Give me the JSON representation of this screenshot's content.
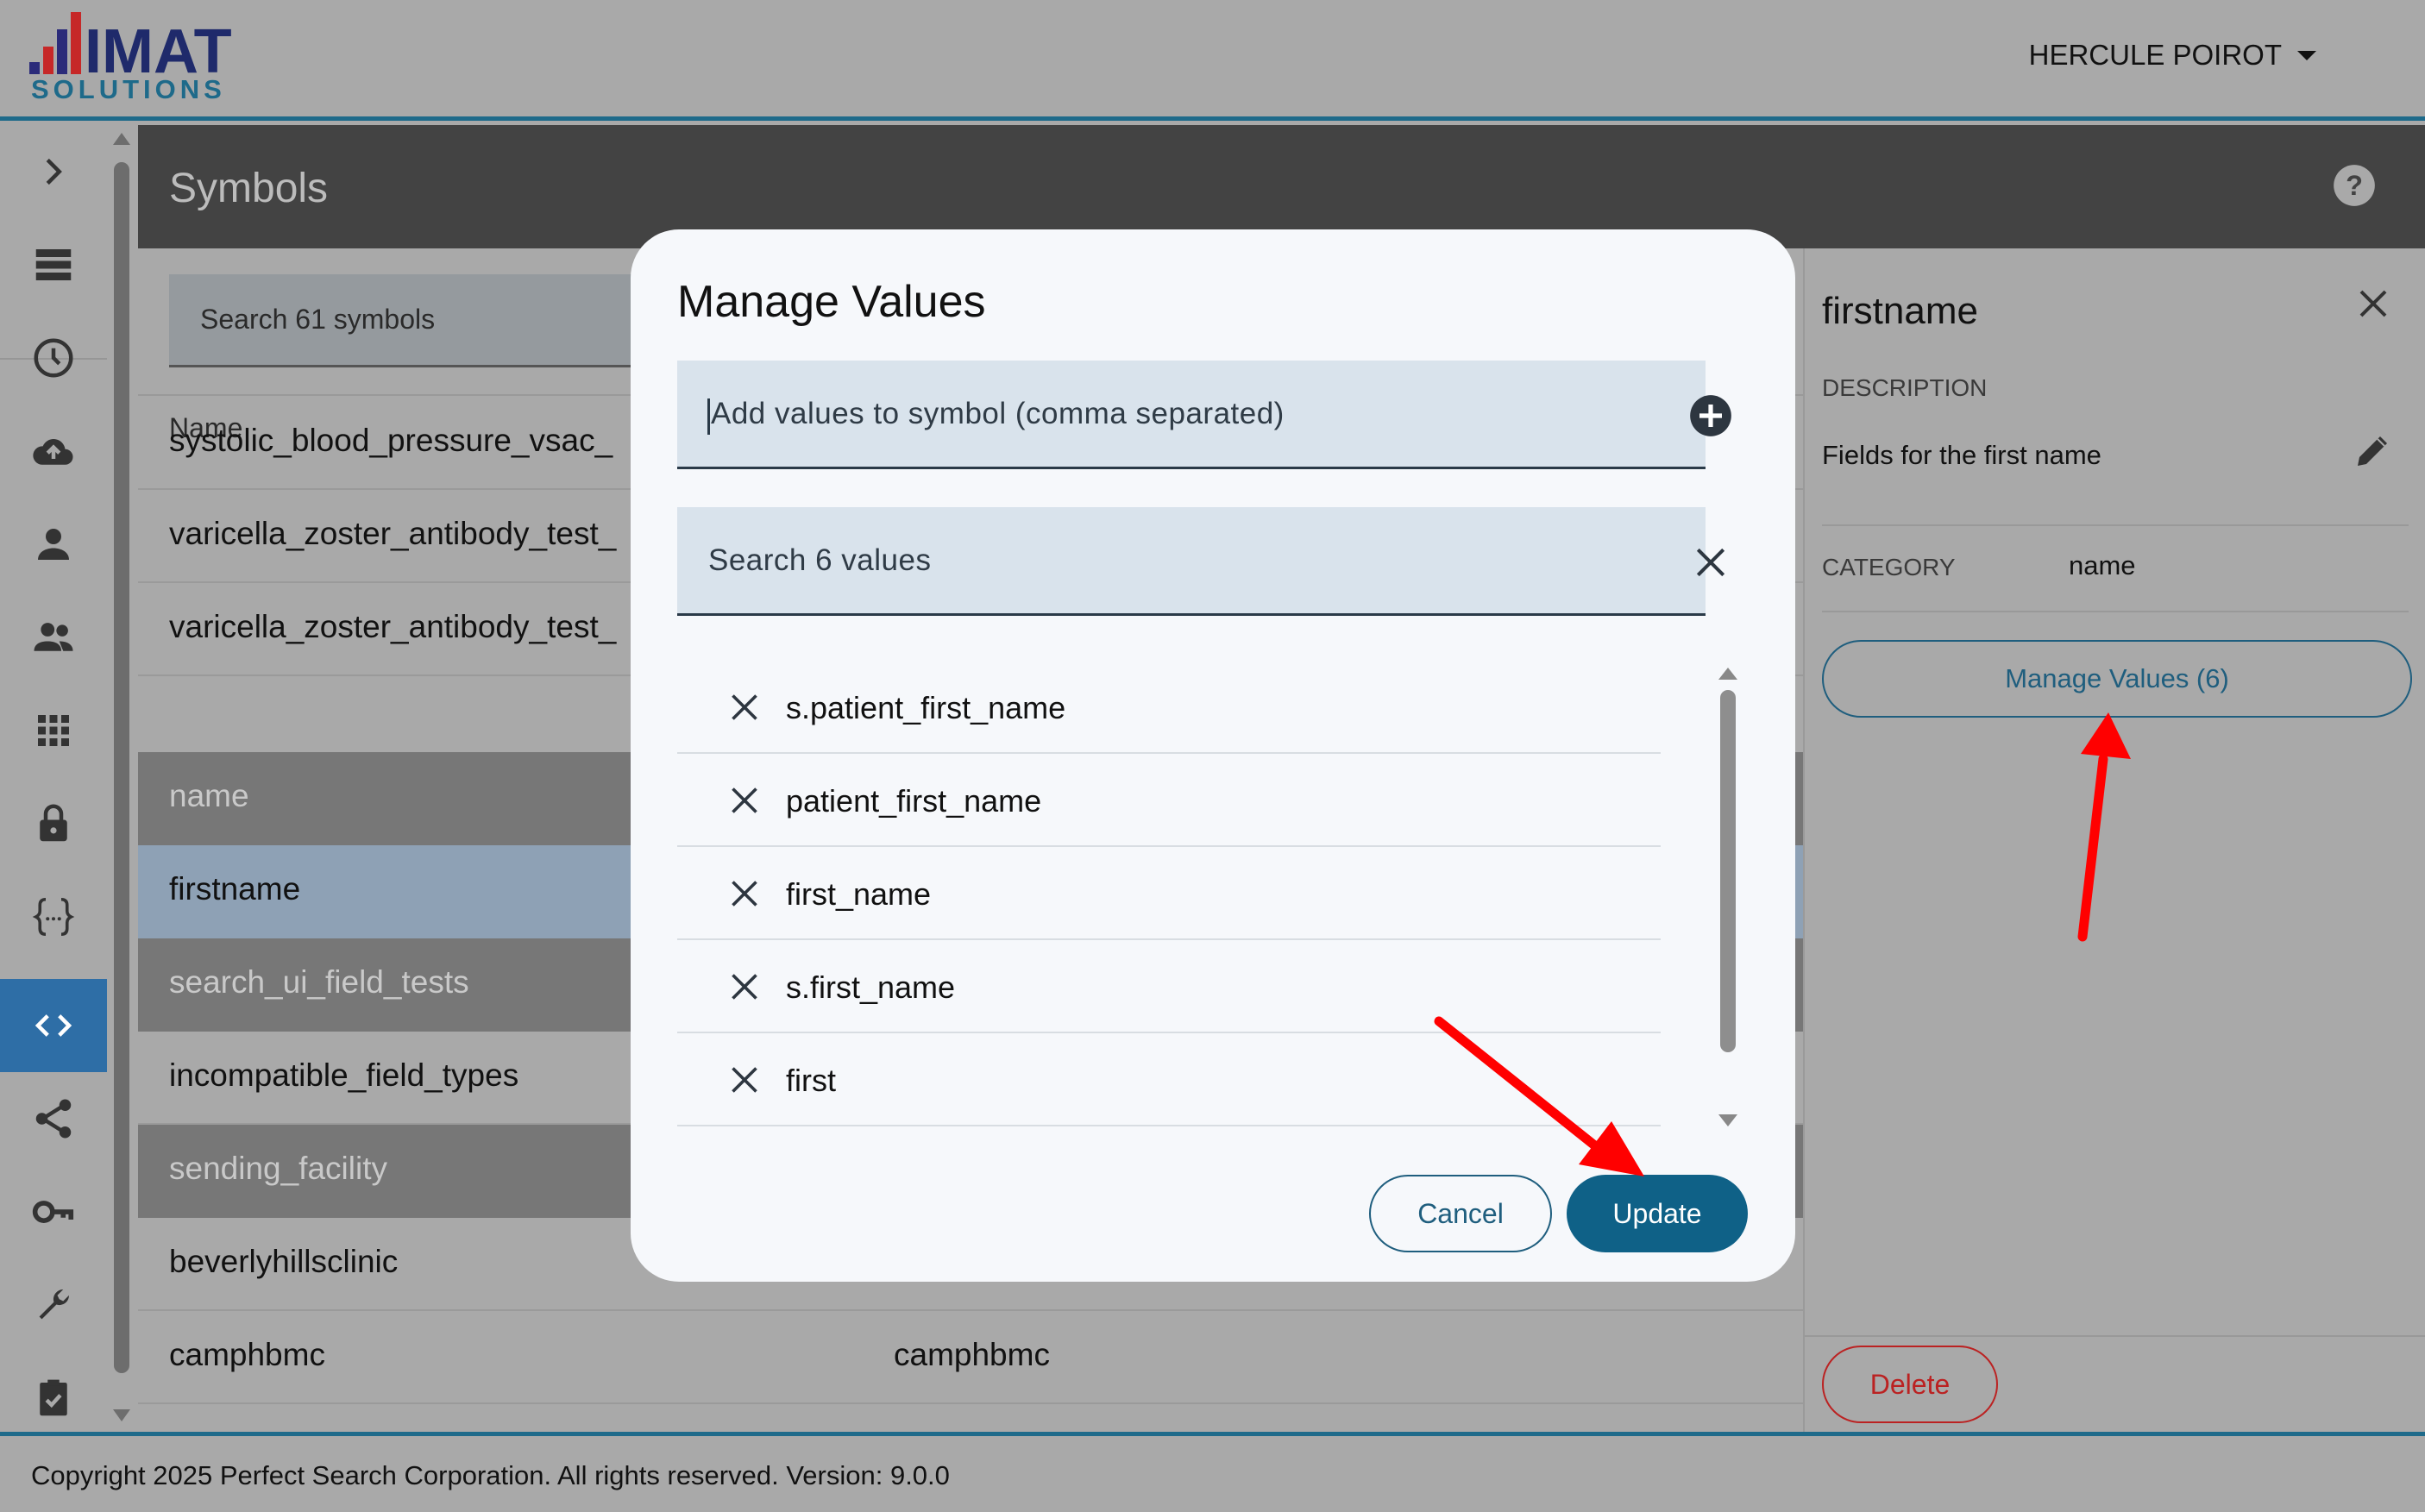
{
  "header": {
    "logo": {
      "line1": "IMAT",
      "line2": "SOLUTIONS"
    },
    "user_name": "HERCULE POIROT"
  },
  "nav": {
    "items": [
      {
        "icon": "chevron-right-icon"
      },
      {
        "icon": "list-icon"
      },
      {
        "icon": "history-icon"
      },
      {
        "icon": "cloud-upload-icon"
      },
      {
        "icon": "person-icon"
      },
      {
        "icon": "people-icon"
      },
      {
        "icon": "apps-grid-icon"
      },
      {
        "icon": "lock-icon"
      },
      {
        "icon": "curly-braces-icon"
      },
      {
        "icon": "code-icon",
        "active": true
      },
      {
        "icon": "share-icon"
      },
      {
        "icon": "key-icon"
      },
      {
        "icon": "wrench-icon"
      },
      {
        "icon": "clipboard-check-icon"
      }
    ]
  },
  "page": {
    "title": "Symbols",
    "search_placeholder": "Search 61 symbols",
    "column_name": "Name"
  },
  "table": {
    "rows": [
      {
        "name": "systolic_blood_pressure_vsac_",
        "value": "",
        "kind": "row"
      },
      {
        "name": "varicella_zoster_antibody_test_",
        "value": "",
        "kind": "row"
      },
      {
        "name": "varicella_zoster_antibody_test_",
        "value": "",
        "kind": "row"
      },
      {
        "name": "name",
        "value": "",
        "kind": "group"
      },
      {
        "name": "firstname",
        "value": "",
        "kind": "selected"
      },
      {
        "name": "search_ui_field_tests",
        "value": "",
        "kind": "group"
      },
      {
        "name": "incompatible_field_types",
        "value": "",
        "kind": "row"
      },
      {
        "name": "sending_facility",
        "value": "",
        "kind": "group"
      },
      {
        "name": "beverlyhillsclinic",
        "value": "",
        "kind": "row"
      },
      {
        "name": "camphbmc",
        "value": "camphbmc",
        "kind": "row"
      }
    ]
  },
  "detail": {
    "title": "firstname",
    "description_label": "DESCRIPTION",
    "description": "Fields for the first name",
    "category_label": "CATEGORY",
    "category": "name",
    "manage_button": "Manage Values (6)",
    "delete_button": "Delete"
  },
  "modal": {
    "title": "Manage Values",
    "add_placeholder": "Add values to symbol (comma separated)",
    "search_placeholder": "Search 6 values",
    "values": [
      "s.patient_first_name",
      "patient_first_name",
      "first_name",
      "s.first_name",
      "first"
    ],
    "cancel": "Cancel",
    "update": "Update"
  },
  "footer": {
    "text": "Copyright 2025 Perfect Search Corporation. All rights reserved. Version: 9.0.0"
  },
  "colors": {
    "accent": "#0f6187",
    "header_border": "#1e6a8a",
    "annotation_arrow": "#ff0000",
    "delete": "#bb2222"
  }
}
